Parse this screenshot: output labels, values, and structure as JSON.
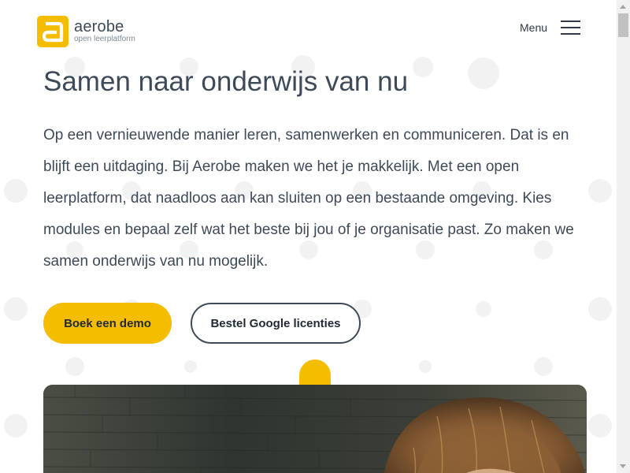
{
  "brand": {
    "name": "aerobe",
    "tagline": "open leerplatform",
    "accent_color": "#f5bd00",
    "text_color": "#3e4a57"
  },
  "header": {
    "menu_label": "Menu",
    "menu_icon": "hamburger-icon"
  },
  "main": {
    "title": "Samen naar onderwijs van nu",
    "intro": "Op een vernieuwende manier leren, samenwerken en communiceren. Dat is en blijft een uitdaging. Bij Aerobe maken we het je makkelijk. Met een open leerplatform, dat naadloos aan kan sluiten op een bestaande omgeving. Kies modules en bepaal zelf wat het beste bij jou of je organisatie past. Zo maken we samen onderwijs van nu mogelijk.",
    "primary_button": "Boek een demo",
    "secondary_button": "Bestel Google licenties"
  },
  "hero": {
    "image_subject": "photo of a person with blonde hair in front of a dark brick wall"
  }
}
